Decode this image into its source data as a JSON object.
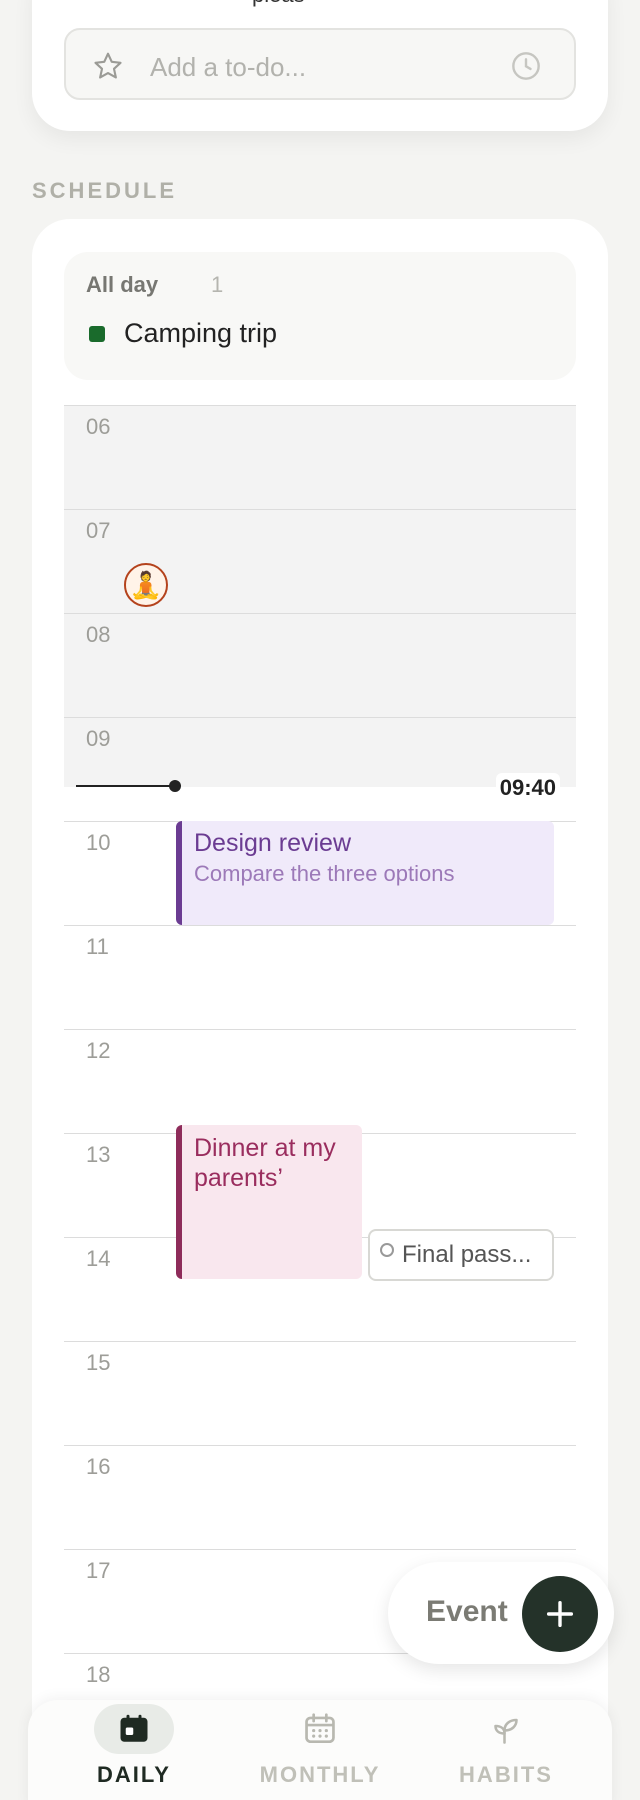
{
  "todo": {
    "clipped_text": "pleas",
    "input_placeholder": "Add a to-do..."
  },
  "schedule": {
    "section_label": "SCHEDULE",
    "all_day": {
      "title": "All day",
      "count": "1",
      "events": [
        {
          "title": "Camping trip",
          "color": "#1a6b2c"
        }
      ]
    },
    "hours": [
      "06",
      "07",
      "08",
      "09",
      "10",
      "11",
      "12",
      "13",
      "14",
      "15",
      "16",
      "17",
      "18"
    ],
    "now_time": "09:40",
    "events": [
      {
        "title": "Design review",
        "subtitle": "Compare the three options",
        "color": "#6b3c92",
        "background": "#f0eafa"
      },
      {
        "title": "Dinner at my parents’",
        "color": "#9a2d5e",
        "background": "#f9e7ee"
      }
    ],
    "todo_chip": {
      "title": "Final pass..."
    },
    "habit_marker": {
      "emoji": "🧘"
    }
  },
  "fab": {
    "label": "Event",
    "icon": "plus-icon"
  },
  "nav": {
    "items": [
      {
        "label": "DAILY",
        "icon": "calendar-day-icon",
        "active": true
      },
      {
        "label": "MONTHLY",
        "icon": "calendar-month-icon",
        "active": false
      },
      {
        "label": "HABITS",
        "icon": "sprout-icon",
        "active": false
      }
    ]
  },
  "colors": {
    "accent_dark": "#243229",
    "background": "#f4f4f2",
    "card": "#ffffff"
  }
}
